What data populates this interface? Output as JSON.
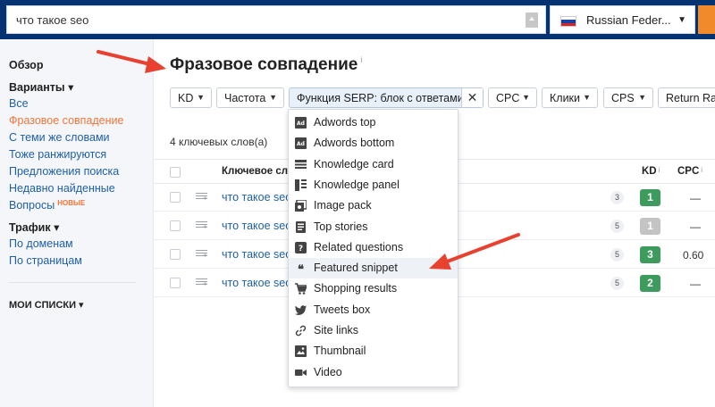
{
  "search": {
    "query": "что такое seo"
  },
  "country": {
    "label": "Russian Feder..."
  },
  "sidebar": {
    "overview": "Обзор",
    "variants": "Варианты ▾",
    "items": [
      "Все",
      "Фразовое совпадение",
      "С теми же словами",
      "Тоже ранжируются",
      "Предложения поиска",
      "Недавно найденные",
      "Вопросы"
    ],
    "new_badge": "НОВЫЕ",
    "traffic": "Трафик ▾",
    "traffic_items": [
      "По доменам",
      "По страницам"
    ],
    "my_lists": "МОИ СПИСКИ ▾"
  },
  "main": {
    "title": "Фразовое совпадение",
    "title_info": "i",
    "filters": {
      "kd": "KD",
      "frequency": "Частота",
      "serp": "Функция SERP: блок с ответами",
      "close": "✕",
      "cpc": "CPC",
      "clicks": "Клики",
      "cps": "CPS",
      "return_rate": "Return Ra"
    },
    "count": "4 ключевых слов(а)",
    "columns": {
      "keyword": "Ключевое сло",
      "kd": "KD",
      "cpc": "CPC",
      "info": "i"
    },
    "rows": [
      {
        "keyword": "что такое seo",
        "num": "3",
        "kd": "1",
        "cpc": "—"
      },
      {
        "keyword": "что такое seo",
        "num": "5",
        "kd": "1",
        "cpc": "—"
      },
      {
        "keyword": "что такое seo",
        "num": "5",
        "kd": "3",
        "cpc": "0.60"
      },
      {
        "keyword": "что такое seo",
        "num": "5",
        "kd": "2",
        "cpc": "—"
      }
    ]
  },
  "dropdown": {
    "items": [
      "Adwords top",
      "Adwords bottom",
      "Knowledge card",
      "Knowledge panel",
      "Image pack",
      "Top stories",
      "Related questions",
      "Featured snippet",
      "Shopping results",
      "Tweets box",
      "Site links",
      "Thumbnail",
      "Video"
    ]
  },
  "colors": {
    "topbar": "#053271",
    "accent_orange": "#f0753a",
    "link_blue": "#1f5fa8",
    "kd_green": "#3e9b5e",
    "kd_gray": "#c4c4c4",
    "arrow_red": "#e8412f"
  }
}
